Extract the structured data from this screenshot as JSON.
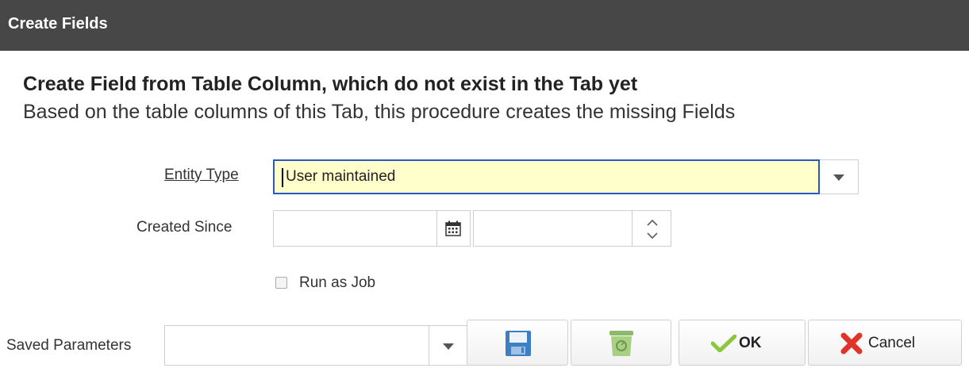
{
  "dialog": {
    "title": "Create Fields",
    "heading": "Create Field from Table Column, which do not exist in the Tab yet",
    "description": "Based on the table columns of this Tab, this procedure creates the missing Fields"
  },
  "form": {
    "entity_type": {
      "label": "Entity Type",
      "value": "User maintained",
      "dropdown_icon": "chevron-down-icon"
    },
    "created_since": {
      "label": "Created Since",
      "date_value": "",
      "time_value": "",
      "calendar_icon": "calendar-icon",
      "spinner_icon": "up-down-spinner-icon"
    },
    "run_as_job": {
      "label": "Run as Job",
      "checked": false
    }
  },
  "footer": {
    "saved_parameters_label": "Saved Parameters",
    "saved_parameters_value": "",
    "save_icon": "floppy-disk-icon",
    "delete_icon": "recycle-bin-icon",
    "ok_label": "OK",
    "ok_icon": "checkmark-icon",
    "cancel_label": "Cancel",
    "cancel_icon": "red-x-icon"
  },
  "colors": {
    "titlebar_bg": "#474747",
    "focused_input_bg": "#ffffcc",
    "focus_border": "#2b57c4",
    "ok_check": "#8cc63f",
    "cancel_x": "#e0342a"
  }
}
